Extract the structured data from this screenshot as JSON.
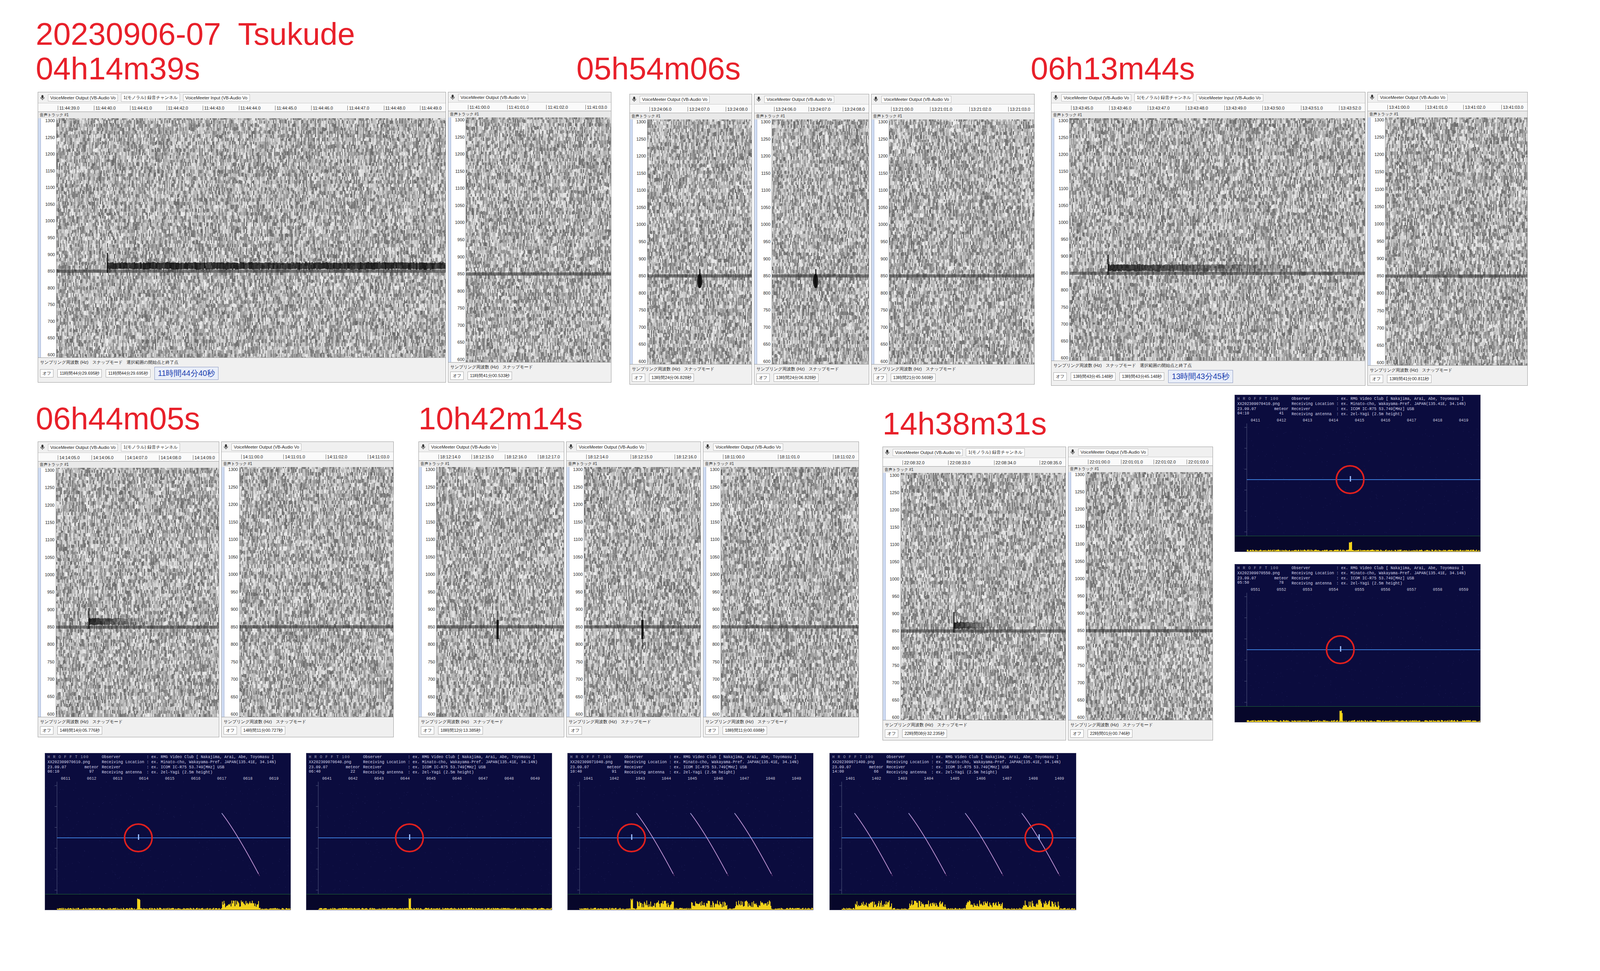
{
  "title": "20230906-07  Tsukude",
  "freq_axis": [
    "1300",
    "1250",
    "1200",
    "1150",
    "1100",
    "1050",
    "1000",
    "950",
    "900",
    "850",
    "800",
    "750",
    "700",
    "650",
    "600"
  ],
  "track_label": "音声トラック #1",
  "events": [
    {
      "label": "04h14m39s",
      "panels": [
        {
          "toolbar": [
            "VoiceMeeter Output (VB-Audio Vo",
            "1(モノラル) 録音チャンネル",
            "VoiceMeeter Input (VB-Audio Vo"
          ],
          "ruler": [
            "11:44:39.0",
            "11:44:40.0",
            "11:44:41.0",
            "11:44:42.0",
            "11:44:43.0",
            "11:44:44.0",
            "11:44:45.0",
            "11:44:46.0",
            "11:44:47.0",
            "11:44:48.0",
            "11:44:49.0"
          ],
          "status_labels": [
            "サンプリング周波数 (Hz)",
            "スナップモード",
            "選択範囲の開始点と終了点"
          ],
          "snap": "オフ",
          "times": [
            "11時間44分29.695秒",
            "11時間44分29.695秒"
          ],
          "clock": "11時間44分40秒",
          "echo": {
            "kind": "trail",
            "start": 0.13,
            "length": 0.87
          }
        },
        {
          "toolbar": [
            "VoiceMeeter Output (VB-Audio Vo"
          ],
          "ruler": [
            "11:41:00.0",
            "11:41:01.0",
            "11:41:02.0",
            "11:41:03.0"
          ],
          "status_labels": [
            "サンプリング周波数 (Hz)",
            "スナップモード"
          ],
          "snap": "オフ",
          "times": [
            "11時間41分00.533秒"
          ],
          "echo": {
            "kind": "none",
            "start": 0,
            "length": 0
          }
        }
      ]
    },
    {
      "label": "05h54m06s",
      "panels": [
        {
          "toolbar": [
            "VoiceMeeter Output (VB-Audio Vo"
          ],
          "ruler": [
            "13:24:06.0",
            "13:24:07.0",
            "13:24:08.0"
          ],
          "status_labels": [
            "サンプリング周波数 (Hz)",
            "スナップモード"
          ],
          "snap": "オフ",
          "times": [
            "13時間24分06.828秒"
          ],
          "echo": {
            "kind": "blip",
            "start": 0.5,
            "length": 0.05
          }
        },
        {
          "toolbar": [
            "VoiceMeeter Output (VB-Audio Vo"
          ],
          "ruler": [
            "13:24:06.0",
            "13:24:07.0",
            "13:24:08.0"
          ],
          "status_labels": [
            "サンプリング周波数 (Hz)",
            "スナップモード"
          ],
          "snap": "オフ",
          "times": [
            "13時間24分06.828秒"
          ],
          "echo": {
            "kind": "blip",
            "start": 0.45,
            "length": 0.05
          }
        },
        {
          "toolbar": [
            "VoiceMeeter Output (VB-Audio Vo"
          ],
          "ruler": [
            "13:21:00.0",
            "13:21:01.0",
            "13:21:02.0",
            "13:21:03.0"
          ],
          "status_labels": [
            "サンプリング周波数 (Hz)",
            "スナップモード"
          ],
          "snap": "オフ",
          "times": [
            "13時間21分00.569秒"
          ],
          "echo": {
            "kind": "none",
            "start": 0,
            "length": 0
          }
        }
      ]
    },
    {
      "label": "06h13m44s",
      "panels": [
        {
          "toolbar": [
            "VoiceMeeter Output (VB-Audio Vo",
            "1(モノラル) 録音チャンネル",
            "VoiceMeeter Input (VB-Audio Vo"
          ],
          "ruler": [
            "13:43:45.0",
            "13:43:46.0",
            "13:43:47.0",
            "13:43:48.0",
            "13:43:49.0",
            "13:43:50.0",
            "13:43:51.0",
            "13:43:52.0"
          ],
          "status_labels": [
            "サンプリング周波数 (Hz)",
            "スナップモード",
            "選択範囲の開始点と終了点"
          ],
          "snap": "オフ",
          "times": [
            "13時間43分45.148秒",
            "13時間43分45.148秒"
          ],
          "clock": "13時間43分45秒",
          "echo": {
            "kind": "fading-trail",
            "start": 0.13,
            "length": 0.62
          }
        },
        {
          "toolbar": [
            "VoiceMeeter Output (VB-Audio Vo"
          ],
          "ruler": [
            "13:41:00.0",
            "13:41:01.0",
            "13:41:02.0",
            "13:41:03.0"
          ],
          "status_labels": [
            "サンプリング周波数 (Hz)",
            "スナップモード"
          ],
          "snap": "オフ",
          "times": [
            "13時間41分00.811秒"
          ],
          "echo": {
            "kind": "none",
            "start": 0,
            "length": 0
          }
        }
      ]
    },
    {
      "label": "06h44m05s",
      "panels": [
        {
          "toolbar": [
            "VoiceMeeter Output (VB-Audio Vo",
            "1(モノラル) 録音チャンネル"
          ],
          "ruler": [
            "14:14:05.0",
            "14:14:06.0",
            "14:14:07.0",
            "14:14:08.0",
            "14:14:09.0"
          ],
          "status_labels": [
            "サンプリング周波数 (Hz)",
            "スナップモード"
          ],
          "snap": "オフ",
          "times": [
            "14時間14分05.776秒"
          ],
          "echo": {
            "kind": "fading-trail",
            "start": 0.2,
            "length": 0.33
          }
        },
        {
          "toolbar": [
            "VoiceMeeter Output (VB-Audio Vo"
          ],
          "ruler": [
            "14:11:00.0",
            "14:11:01.0",
            "14:11:02.0",
            "14:11:03.0"
          ],
          "status_labels": [
            "サンプリング周波数 (Hz)",
            "スナップモード"
          ],
          "snap": "オフ",
          "times": [
            "14時間11分00.727秒"
          ],
          "echo": {
            "kind": "none",
            "start": 0,
            "length": 0
          }
        }
      ]
    },
    {
      "label": "10h42m14s",
      "panels": [
        {
          "toolbar": [
            "VoiceMeeter Output (VB-Audio Vo"
          ],
          "ruler": [
            "18:12:14.0",
            "18:12:15.0",
            "18:12:16.0",
            "18:12:17.0"
          ],
          "status_labels": [
            "サンプリング周波数 (Hz)",
            "スナップモード"
          ],
          "snap": "オフ",
          "times": [
            "18時間12分13.385秒"
          ],
          "echo": {
            "kind": "spike",
            "start": 0.48,
            "length": 0.02
          }
        },
        {
          "toolbar": [
            "VoiceMeeter Output (VB-Audio Vo"
          ],
          "ruler": [
            "18:12:14.0",
            "18:12:15.0",
            "18:12:16.0"
          ],
          "status_labels": [
            "サンプリング周波数 (Hz)",
            "スナップモード"
          ],
          "snap": "オフ",
          "times": [],
          "echo": {
            "kind": "spike",
            "start": 0.5,
            "length": 0.02
          }
        },
        {
          "toolbar": [
            "VoiceMeeter Output (VB-Audio Vo"
          ],
          "ruler": [
            "18:11:00.0",
            "18:11:01.0",
            "18:11:02.0"
          ],
          "status_labels": [
            "サンプリング周波数 (Hz)",
            "スナップモード"
          ],
          "snap": "オフ",
          "times": [
            "18時間11分00.698秒"
          ],
          "echo": {
            "kind": "none",
            "start": 0,
            "length": 0
          }
        }
      ]
    },
    {
      "label": "14h38m31s",
      "panels": [
        {
          "toolbar": [
            "VoiceMeeter Output (VB-Audio Vo",
            "1(モノラル) 録音チャンネル"
          ],
          "ruler": [
            "22:08:32.0",
            "22:08:33.0",
            "22:08:34.0",
            "22:08:35.0"
          ],
          "status_labels": [
            "サンプリング周波数 (Hz)",
            "スナップモード"
          ],
          "snap": "オフ",
          "times": [
            "22時間08分32.235秒"
          ],
          "echo": {
            "kind": "fading-trail",
            "start": 0.32,
            "length": 0.22
          }
        },
        {
          "toolbar": [
            "VoiceMeeter Output (VB-Audio Vo"
          ],
          "ruler": [
            "22:01:00.0",
            "22:01:01.0",
            "22:01:02.0",
            "22:01:03.0"
          ],
          "status_labels": [
            "サンプリング周波数 (Hz)",
            "スナップモード"
          ],
          "snap": "オフ",
          "times": [
            "22時間01分00.746秒"
          ],
          "echo": {
            "kind": "none",
            "start": 0,
            "length": 0
          }
        }
      ]
    }
  ],
  "hrofft_title": "H R O F F T 100",
  "meteor_label": "meteor",
  "hrofft_header": [
    "Observer           : ex. RMG Video Club [ Nakajima, Arai, Abe, Toyomasu ]",
    "Receiving Location : ex. Minato-cho, Wakayama-Pref. JAPAN(135.41E, 34.14N)",
    "Receiver           : ex. ICOM IC-R75 53.749[MHz] USB",
    "Receiving antenna  : ex. 2el-Yagi (2.5m height)"
  ],
  "hrofft": [
    {
      "file": "XX202309070410.png",
      "date": "23.09.07 04:10",
      "count": "41",
      "ticks": [
        "0411",
        "0412",
        "0413",
        "0414",
        "0415",
        "0416",
        "0417",
        "0418",
        "0419"
      ],
      "marker": 0.47,
      "trails": []
    },
    {
      "file": "XX202309070550.png",
      "date": "23.09.07 05:50",
      "count": "78",
      "ticks": [
        "0551",
        "0552",
        "0553",
        "0554",
        "0555",
        "0556",
        "0557",
        "0558",
        "0559"
      ],
      "marker": 0.43,
      "trails": []
    },
    {
      "file": "XX202309070610.png",
      "date": "23.09.07 06:10",
      "count": "97",
      "ticks": [
        "0611",
        "0612",
        "0613",
        "0614",
        "0615",
        "0616",
        "0617",
        "0618",
        "0619"
      ],
      "marker": 0.38,
      "trails": [
        0.72
      ]
    },
    {
      "file": "XX202309070640.png",
      "date": "23.09.07 06:40",
      "count": "22",
      "ticks": [
        "0641",
        "0642",
        "0643",
        "0644",
        "0645",
        "0646",
        "0647",
        "0648",
        "0649"
      ],
      "marker": 0.42,
      "trails": []
    },
    {
      "file": "XX202309071040.png",
      "date": "23.09.07 10:40",
      "count": "91",
      "ticks": [
        "1041",
        "1042",
        "1043",
        "1044",
        "1045",
        "1046",
        "1047",
        "1048",
        "1049"
      ],
      "marker": 0.26,
      "trails": [
        0.28,
        0.5,
        0.68
      ]
    },
    {
      "file": "XX202309071400.png",
      "date": "23.09.07 14:00",
      "count": "66",
      "ticks": [
        "1401",
        "1402",
        "1403",
        "1404",
        "1405",
        "1406",
        "1407",
        "1408",
        "1409"
      ],
      "marker": 0.85,
      "trails": [
        0.1,
        0.32,
        0.55,
        0.78
      ]
    }
  ]
}
